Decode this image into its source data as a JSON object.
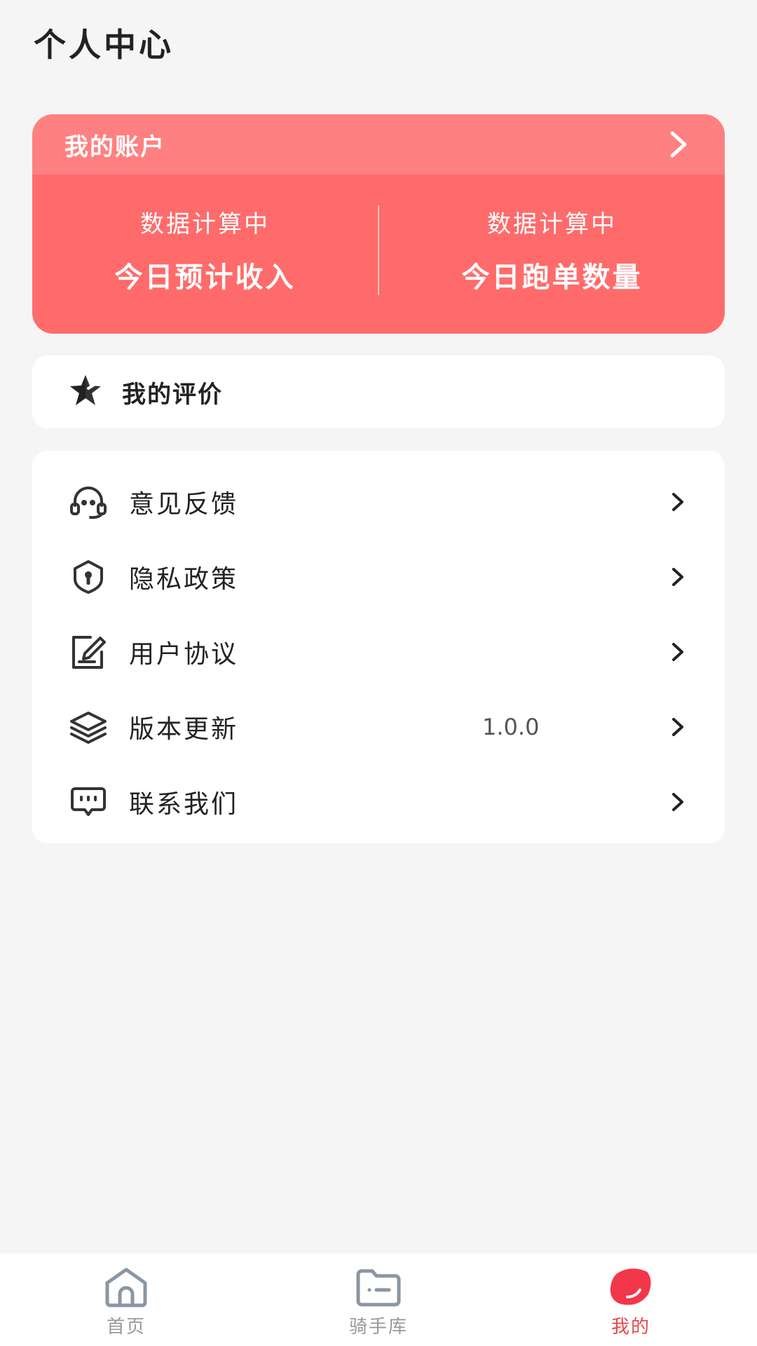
{
  "page": {
    "title": "个人中心"
  },
  "account": {
    "header_label": "我的账户",
    "stats": [
      {
        "value": "数据计算中",
        "label": "今日预计收入"
      },
      {
        "value": "数据计算中",
        "label": "今日跑单数量"
      }
    ]
  },
  "review": {
    "label": "我的评价",
    "icon": "star-icon"
  },
  "menu": {
    "items": [
      {
        "label": "意见反馈",
        "icon": "headset-icon",
        "value": ""
      },
      {
        "label": "隐私政策",
        "icon": "shield-lock-icon",
        "value": ""
      },
      {
        "label": "用户协议",
        "icon": "edit-document-icon",
        "value": ""
      },
      {
        "label": "版本更新",
        "icon": "layers-icon",
        "value": "1.0.0"
      },
      {
        "label": "联系我们",
        "icon": "chat-icon",
        "value": ""
      }
    ]
  },
  "nav": {
    "items": [
      {
        "label": "首页",
        "icon": "home-icon",
        "active": false
      },
      {
        "label": "骑手库",
        "icon": "folder-icon",
        "active": false
      },
      {
        "label": "我的",
        "icon": "profile-icon",
        "active": true
      }
    ]
  },
  "colors": {
    "accent": "#ff6b6b",
    "accent_header": "#ff8080",
    "active_nav": "#e8474b",
    "background": "#f5f5f5"
  }
}
